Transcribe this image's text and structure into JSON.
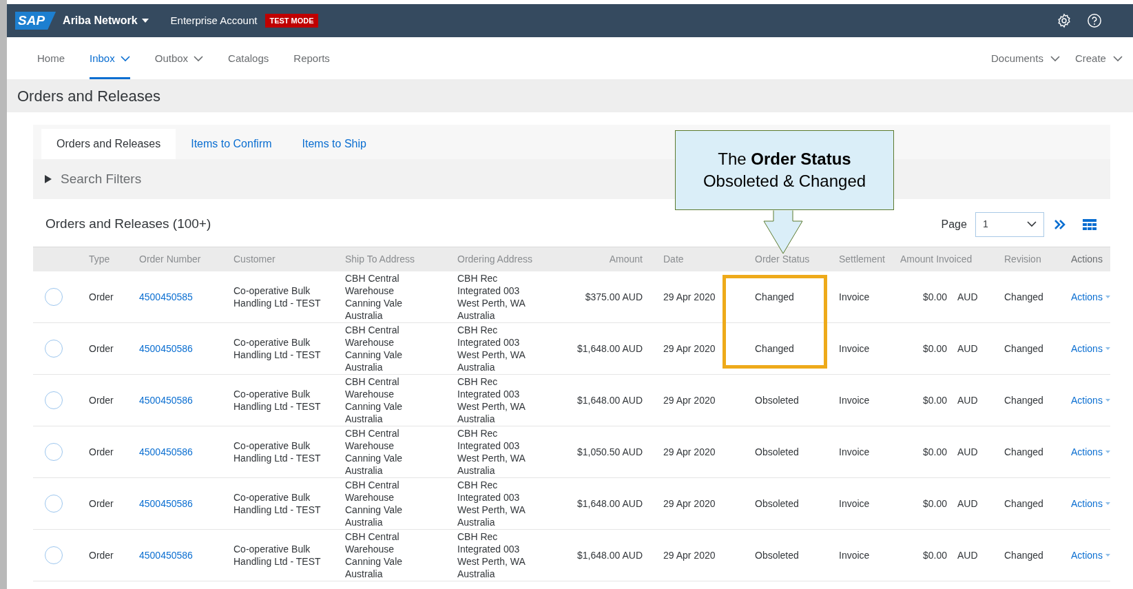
{
  "header": {
    "logo": "SAP",
    "product": "Ariba Network",
    "account": "Enterprise Account",
    "badge": "TEST MODE"
  },
  "nav": {
    "items": [
      {
        "label": "Home",
        "selected": false,
        "dropdown": false
      },
      {
        "label": "Inbox",
        "selected": true,
        "dropdown": true
      },
      {
        "label": "Outbox",
        "selected": false,
        "dropdown": true
      },
      {
        "label": "Catalogs",
        "selected": false,
        "dropdown": false
      },
      {
        "label": "Reports",
        "selected": false,
        "dropdown": false
      }
    ],
    "right_items": [
      {
        "label": "Documents"
      },
      {
        "label": "Create"
      }
    ]
  },
  "page_title": "Orders and Releases",
  "tabs": [
    {
      "label": "Orders and Releases",
      "selected": true
    },
    {
      "label": "Items to Confirm",
      "selected": false
    },
    {
      "label": "Items to Ship",
      "selected": false
    }
  ],
  "search_filters": {
    "label": "Search Filters",
    "expanded": false
  },
  "table": {
    "title": "Orders and Releases (100+)",
    "page_label": "Page",
    "page_value": "1",
    "columns": [
      "Type",
      "Order Number",
      "Customer",
      "Ship To Address",
      "Ordering Address",
      "Amount",
      "Date",
      "Order Status",
      "Settlement",
      "Amount Invoiced",
      "Revision",
      "Actions"
    ],
    "rows": [
      {
        "selected": false,
        "highlighted": true,
        "type": "Order",
        "order_number": "4500450585",
        "customer": [
          "Co-operative Bulk",
          "Handling Ltd - TEST"
        ],
        "ship_to": [
          "CBH Central",
          "Warehouse",
          "Canning Vale",
          "Australia"
        ],
        "ordering": [
          "CBH Rec",
          "Integrated 003",
          "West Perth, WA",
          "Australia"
        ],
        "amount": "$375.00 AUD",
        "date": "29 Apr 2020",
        "status": "Changed",
        "settlement": "Invoice",
        "invoiced": "$0.00",
        "currency": "AUD",
        "revision": "Changed",
        "actions": "Actions"
      },
      {
        "selected": false,
        "highlighted": true,
        "type": "Order",
        "order_number": "4500450586",
        "customer": [
          "Co-operative Bulk",
          "Handling Ltd - TEST"
        ],
        "ship_to": [
          "CBH Central",
          "Warehouse",
          "Canning Vale",
          "Australia"
        ],
        "ordering": [
          "CBH Rec",
          "Integrated 003",
          "West Perth, WA",
          "Australia"
        ],
        "amount": "$1,648.00 AUD",
        "date": "29 Apr 2020",
        "status": "Changed",
        "settlement": "Invoice",
        "invoiced": "$0.00",
        "currency": "AUD",
        "revision": "Changed",
        "actions": "Actions"
      },
      {
        "selected": false,
        "highlighted": false,
        "type": "Order",
        "order_number": "4500450586",
        "customer": [
          "Co-operative Bulk",
          "Handling Ltd - TEST"
        ],
        "ship_to": [
          "CBH Central",
          "Warehouse",
          "Canning Vale",
          "Australia"
        ],
        "ordering": [
          "CBH Rec",
          "Integrated 003",
          "West Perth, WA",
          "Australia"
        ],
        "amount": "$1,648.00 AUD",
        "date": "29 Apr 2020",
        "status": "Obsoleted",
        "settlement": "Invoice",
        "invoiced": "$0.00",
        "currency": "AUD",
        "revision": "Changed",
        "actions": "Actions"
      },
      {
        "selected": false,
        "highlighted": false,
        "type": "Order",
        "order_number": "4500450586",
        "customer": [
          "Co-operative Bulk",
          "Handling Ltd - TEST"
        ],
        "ship_to": [
          "CBH Central",
          "Warehouse",
          "Canning Vale",
          "Australia"
        ],
        "ordering": [
          "CBH Rec",
          "Integrated 003",
          "West Perth, WA",
          "Australia"
        ],
        "amount": "$1,050.50 AUD",
        "date": "29 Apr 2020",
        "status": "Obsoleted",
        "settlement": "Invoice",
        "invoiced": "$0.00",
        "currency": "AUD",
        "revision": "Changed",
        "actions": "Actions"
      },
      {
        "selected": false,
        "highlighted": false,
        "type": "Order",
        "order_number": "4500450586",
        "customer": [
          "Co-operative Bulk",
          "Handling Ltd - TEST"
        ],
        "ship_to": [
          "CBH Central",
          "Warehouse",
          "Canning Vale",
          "Australia"
        ],
        "ordering": [
          "CBH Rec",
          "Integrated 003",
          "West Perth, WA",
          "Australia"
        ],
        "amount": "$1,648.00 AUD",
        "date": "29 Apr 2020",
        "status": "Obsoleted",
        "settlement": "Invoice",
        "invoiced": "$0.00",
        "currency": "AUD",
        "revision": "Changed",
        "actions": "Actions"
      },
      {
        "selected": false,
        "highlighted": false,
        "type": "Order",
        "order_number": "4500450586",
        "customer": [
          "Co-operative Bulk",
          "Handling Ltd - TEST"
        ],
        "ship_to": [
          "CBH Central",
          "Warehouse",
          "Canning Vale",
          "Australia"
        ],
        "ordering": [
          "CBH Rec",
          "Integrated 003",
          "West Perth, WA",
          "Australia"
        ],
        "amount": "$1,648.00 AUD",
        "date": "29 Apr 2020",
        "status": "Obsoleted",
        "settlement": "Invoice",
        "invoiced": "$0.00",
        "currency": "AUD",
        "revision": "Changed",
        "actions": "Actions"
      }
    ]
  },
  "callout": {
    "lines": [
      "The **Order Status**",
      "Obsoleted & Changed"
    ]
  }
}
